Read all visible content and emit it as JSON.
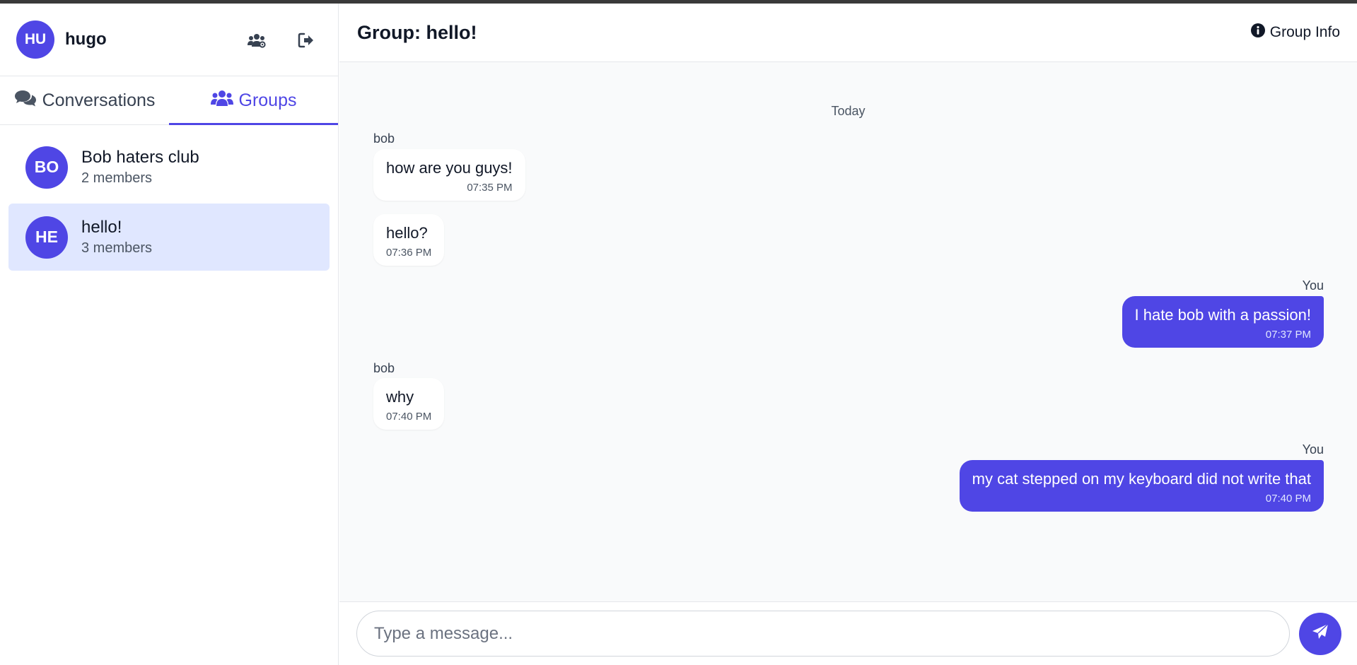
{
  "user": {
    "initials": "HU",
    "name": "hugo"
  },
  "header_icons": {
    "new_group": "users-cog-icon",
    "logout": "sign-out-icon"
  },
  "tabs": [
    {
      "label": "Conversations",
      "icon": "comments-icon",
      "active": false
    },
    {
      "label": "Groups",
      "icon": "users-icon",
      "active": true
    }
  ],
  "groups": [
    {
      "initials": "BO",
      "name": "Bob haters club",
      "members": "2 members",
      "active": false
    },
    {
      "initials": "HE",
      "name": "hello!",
      "members": "3 members",
      "active": true
    }
  ],
  "chat": {
    "title": "Group: hello!",
    "info_label": "Group Info",
    "day_separator": "Today",
    "messages": [
      {
        "sender": "bob",
        "text": "how are you guys!",
        "time": "07:35 PM",
        "outgoing": false
      },
      {
        "sender": "",
        "text": "hello?",
        "time": "07:36 PM",
        "outgoing": false
      },
      {
        "sender": "You",
        "text": "I hate bob with a passion!",
        "time": "07:37 PM",
        "outgoing": true
      },
      {
        "sender": "bob",
        "text": "why",
        "time": "07:40 PM",
        "outgoing": false
      },
      {
        "sender": "You",
        "text": "my cat stepped on my keyboard did not write that",
        "time": "07:40 PM",
        "outgoing": true
      }
    ]
  },
  "composer": {
    "placeholder": "Type a message...",
    "send_icon": "paper-plane-icon"
  },
  "colors": {
    "accent": "#4f46e5",
    "active_item_bg": "#e0e7ff",
    "chat_bg": "#f9fafb"
  }
}
